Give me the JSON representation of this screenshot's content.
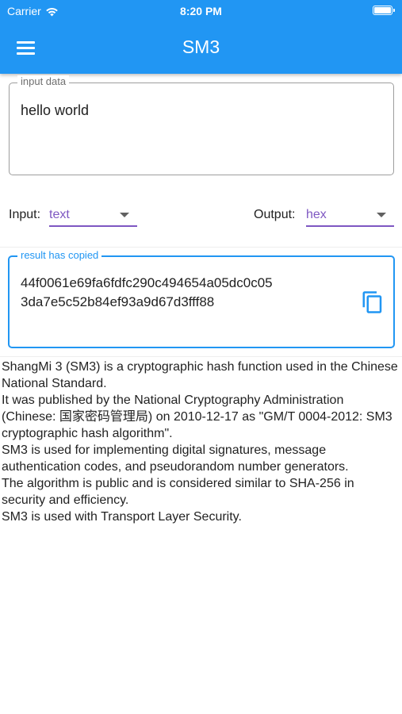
{
  "status_bar": {
    "carrier": "Carrier",
    "time": "8:20 PM"
  },
  "app_bar": {
    "title": "SM3"
  },
  "input_field": {
    "label": "input data",
    "value": "hello world"
  },
  "input_format": {
    "label": "Input:",
    "value": "text"
  },
  "output_format": {
    "label": "Output:",
    "value": "hex"
  },
  "result_field": {
    "label": "result has copied",
    "line1": "44f0061e69fa6fdfc290c494654a05dc0c05",
    "line2": "3da7e5c52b84ef93a9d67d3fff88"
  },
  "description": [
    "ShangMi 3 (SM3) is a cryptographic hash function used in the Chinese National Standard.",
    "It was published by the National Cryptography Administration (Chinese: 国家密码管理局) on 2010-12-17 as \"GM/T 0004-2012: SM3 cryptographic hash algorithm\".",
    "SM3 is used for implementing digital signatures, message authentication codes, and pseudorandom number generators.",
    "The algorithm is public and is considered similar to SHA-256 in security and efficiency.",
    "SM3 is used with Transport Layer Security."
  ],
  "colors": {
    "primary": "#2196f3",
    "accent": "#7e57c2",
    "border": "#9e9e9e"
  },
  "icons": [
    "wifi-icon",
    "battery-icon",
    "menu-icon",
    "dropdown-icon",
    "copy-icon"
  ]
}
